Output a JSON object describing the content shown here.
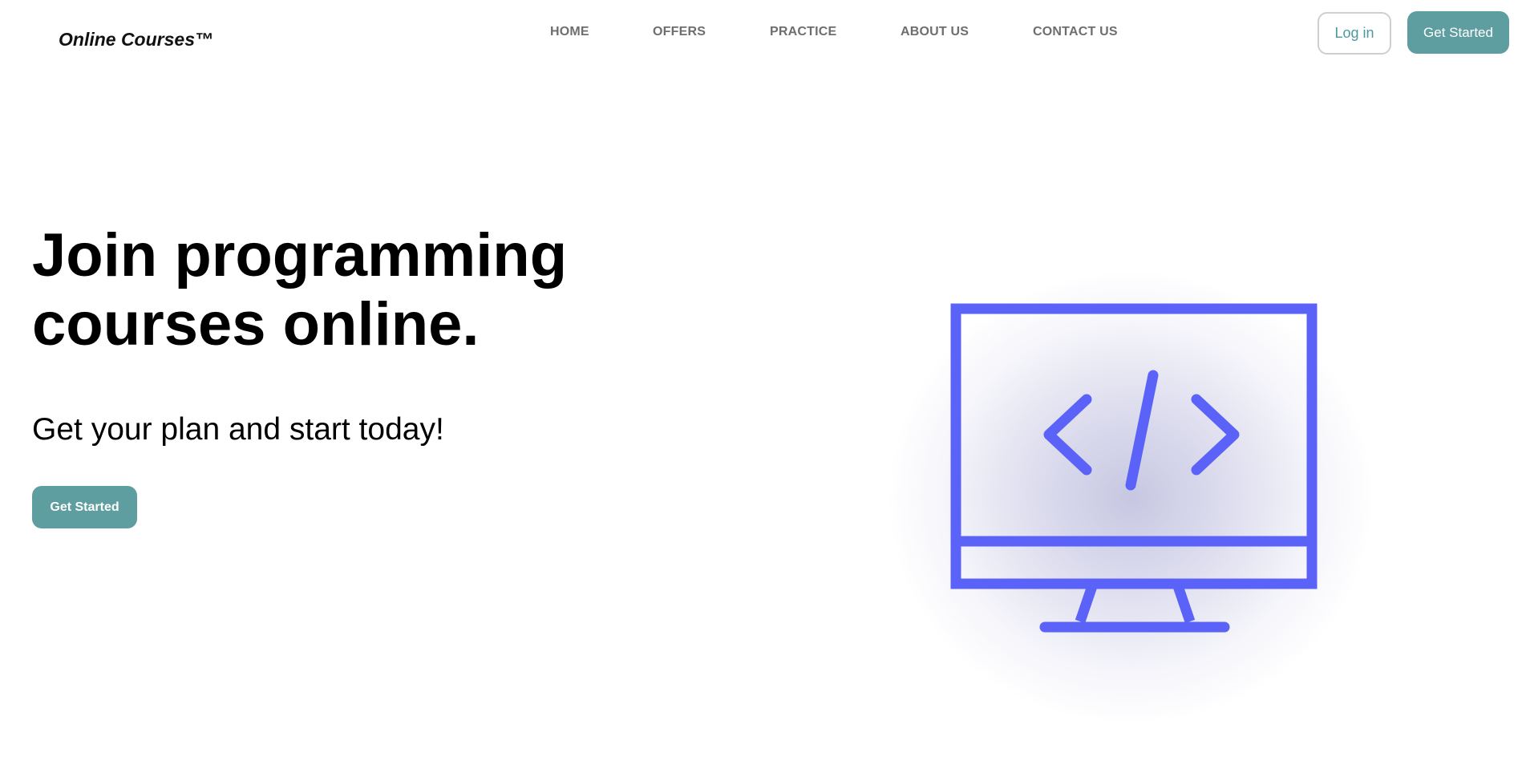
{
  "brand": {
    "logo": "Online Courses™"
  },
  "nav": {
    "items": [
      {
        "label": "HOME"
      },
      {
        "label": "OFFERS"
      },
      {
        "label": "PRACTICE"
      },
      {
        "label": "ABOUT US"
      },
      {
        "label": "CONTACT US"
      }
    ]
  },
  "header": {
    "login_label": "Log in",
    "get_started_label": "Get Started"
  },
  "hero": {
    "title_line1": "Join programming",
    "title_line2": "courses online.",
    "subtitle": "Get your plan and start today!",
    "cta_label": "Get Started",
    "illustration_icon": "monitor-code-icon"
  },
  "colors": {
    "accent": "#5f9ea0",
    "login_text": "#4b9aa0",
    "nav_text": "#6e6e6e",
    "illustration_stroke": "#5b62f8"
  }
}
